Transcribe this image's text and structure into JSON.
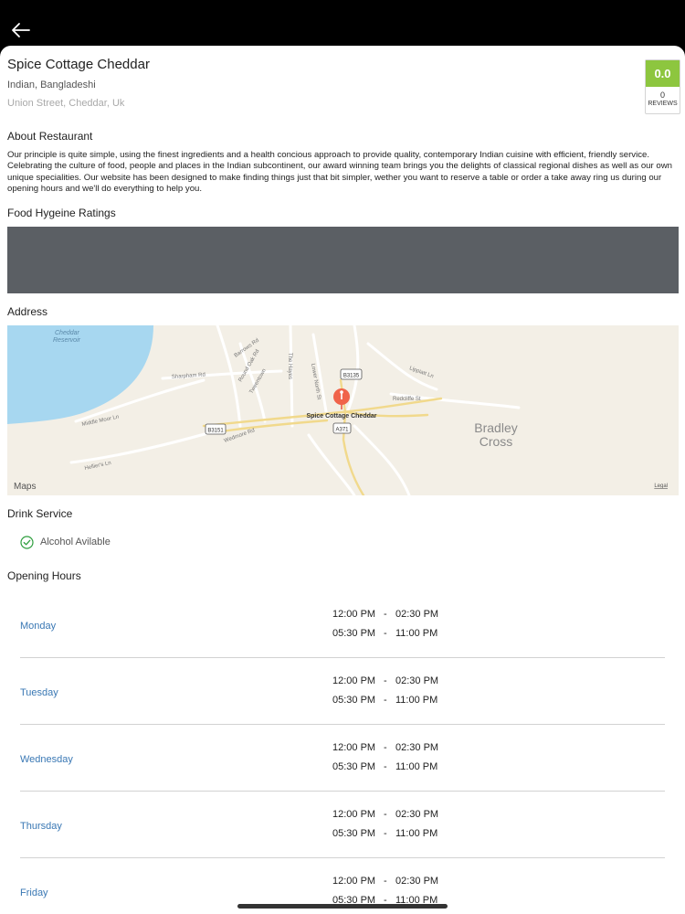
{
  "restaurant": {
    "name": "Spice Cottage Cheddar",
    "cuisine": "Indian, Bangladeshi",
    "address": "Union Street, Cheddar, Uk",
    "rating": "0.0",
    "reviews_count": "0",
    "reviews_label": "REVIEWS",
    "rating_color": "#8dc63f"
  },
  "sections": {
    "about_title": "About Restaurant",
    "about_text": "Our principle is quite simple, using the finest ingredients and a health concious approach to provide quality, contemporary Indian cuisine with efficient, friendly service. Celebrating the culture of food, people and places in the Indian subcontinent, our award winning team brings you the delights of classical regional dishes as well as our own unique specialities. Our website has been designed to make finding things just that bit simpler, wether you want to reserve a table or order a take away ring us during our opening hours and we'll do everything to help you.",
    "hygiene_title": "Food Hygeine Ratings",
    "address_title": "Address",
    "drink_title": "Drink Service",
    "alcohol_label": "Alcohol Avilable",
    "hours_title": "Opening Hours"
  },
  "map": {
    "pin_label": "Spice Cottage Cheddar",
    "area_label_1": "Bradley",
    "area_label_2": "Cross",
    "water_label_1": "Cheddar",
    "water_label_2": "Reservoir",
    "road_b3135": "B3135",
    "road_b3151": "B3151",
    "road_a371": "A371",
    "street_barrows": "Barrows Rd",
    "street_hayes": "The Hayes",
    "street_lower_north": "Lower North St",
    "street_sharpham": "Sharpham Rd",
    "street_middle_moor": "Middle Moor Ln",
    "street_wedmore": "Wedmore Rd",
    "street_hellier": "Hellier's Ln",
    "street_redcliffe": "Redcliffe St",
    "street_lippiatt": "Lippiatt Ln",
    "street_round_oak": "Round Oak Rd",
    "street_tweentown": "Tweentown",
    "brand": "Maps",
    "legal": "Legal"
  },
  "hours": [
    {
      "day": "Monday",
      "open1": "12:00 PM",
      "close1": "02:30 PM",
      "open2": "05:30 PM",
      "close2": "11:00 PM"
    },
    {
      "day": "Tuesday",
      "open1": "12:00 PM",
      "close1": "02:30 PM",
      "open2": "05:30 PM",
      "close2": "11:00 PM"
    },
    {
      "day": "Wednesday",
      "open1": "12:00 PM",
      "close1": "02:30 PM",
      "open2": "05:30 PM",
      "close2": "11:00 PM"
    },
    {
      "day": "Thursday",
      "open1": "12:00 PM",
      "close1": "02:30 PM",
      "open2": "05:30 PM",
      "close2": "11:00 PM"
    },
    {
      "day": "Friday",
      "open1": "12:00 PM",
      "close1": "02:30 PM",
      "open2": "05:30 PM",
      "close2": "11:00 PM"
    }
  ],
  "separator": "-",
  "icons": {
    "back": "arrow-left-icon",
    "check": "check-circle-icon",
    "pin": "map-pin-icon"
  }
}
